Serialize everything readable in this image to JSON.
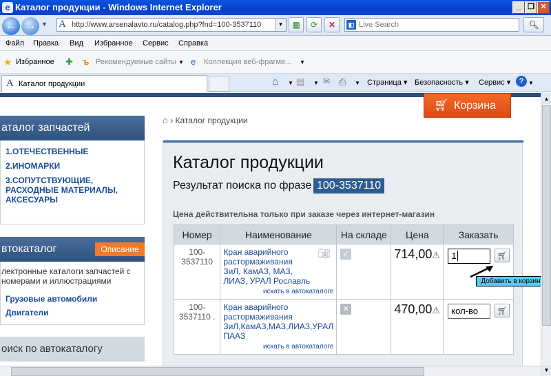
{
  "window": {
    "title": "Каталог продукции - Windows Internet Explorer"
  },
  "address": {
    "url": "http://www.arsenalavto.ru/catalog.php?fnd=100-3537110",
    "search_placeholder": "Live Search"
  },
  "menu": [
    "Файл",
    "Правка",
    "Вид",
    "Избранное",
    "Сервис",
    "Справка"
  ],
  "favbar": {
    "favorites": "Избранное",
    "recommended": "Рекомендуемые сайты",
    "collection": "Коллекция веб-фрагме..."
  },
  "tab": {
    "title": "Каталог продукции"
  },
  "commandbar": {
    "page": "Страница",
    "security": "Безопасность",
    "tools": "Сервис"
  },
  "cart": {
    "label": "Корзина"
  },
  "sidebar": {
    "catalog_title": "аталог запчастей",
    "catalog_links": [
      "1.ОТЕЧЕСТВЕННЫЕ",
      "2.ИНОМАРКИ",
      "3.СОПУТСТВУЮЩИЕ, РАСХОДНЫЕ МАТЕРИАЛЫ, АКСЕСУАРЫ"
    ],
    "autocatalog_title": "втокаталог",
    "description_badge": "Описание",
    "autocatalog_text": "лектронные каталоги запчастей с номерами и иллюстрациями",
    "autocatalog_links": [
      "Грузовые автомобили",
      "Двигатели"
    ],
    "search_title": "оиск по автокаталогу"
  },
  "breadcrumb": {
    "current": "Каталог продукции"
  },
  "main": {
    "title": "Каталог продукции",
    "result_label": "Результат поиска по фразе",
    "query": "100-3537110",
    "note": "Цена действительна только при заказе через интернет-магазин"
  },
  "table": {
    "headers": [
      "Номер",
      "Наименование",
      "На складе",
      "Цена",
      "Заказать"
    ],
    "rows": [
      {
        "number": "100-\n3537110",
        "name": "Кран аварийного растормаживания ЗиЛ, КамАЗ, МАЗ, ЛИАЗ, УРАЛ Рославль",
        "search": "искать в автокаталоге",
        "price": "714,00",
        "qty": "1"
      },
      {
        "number": "100-\n3537110 .",
        "name": "Кран аварийного растормаживания ЗиЛ,КамАЗ,МАЗ,ЛИАЗ,УРАЛ ПААЗ",
        "search": "искать в автокаталоге",
        "price": "470,00",
        "qty": "кол-во"
      }
    ]
  },
  "tooltip": {
    "text": "Добавить в корзину"
  },
  "colors": {
    "accent_orange": "#f26a2c",
    "header_blue": "#2d527f",
    "link_blue": "#1a4b9a"
  }
}
